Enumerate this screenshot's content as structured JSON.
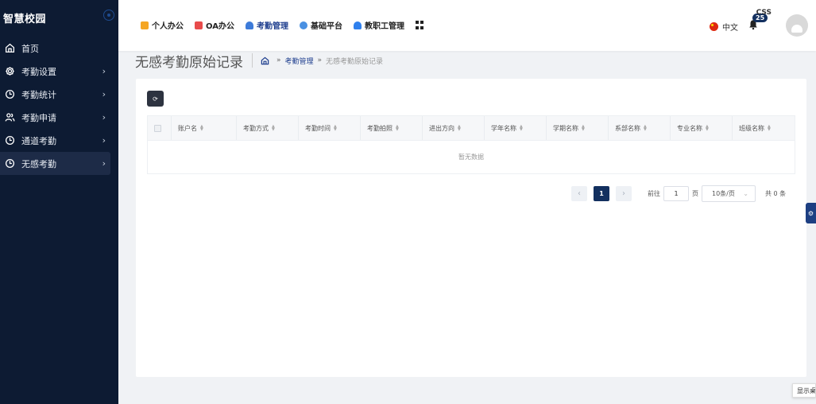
{
  "sidebar": {
    "logo": "智慧校园",
    "items": [
      {
        "label": "首页",
        "icon": "home-icon"
      },
      {
        "label": "考勤设置",
        "icon": "gear-icon"
      },
      {
        "label": "考勤统计",
        "icon": "clock-icon"
      },
      {
        "label": "考勤申请",
        "icon": "users-icon"
      },
      {
        "label": "通道考勤",
        "icon": "clock-icon"
      },
      {
        "label": "无感考勤",
        "icon": "clock-icon"
      }
    ]
  },
  "header": {
    "nav": [
      {
        "label": "个人办公",
        "color": "#f5a623"
      },
      {
        "label": "OA办公",
        "color": "#e84b4b"
      },
      {
        "label": "考勤管理",
        "color": "#3d7bd9"
      },
      {
        "label": "基础平台",
        "color": "#4a90e2"
      },
      {
        "label": "教职工管理",
        "color": "#2f80ed"
      }
    ],
    "language": "中文",
    "notification_count": "25",
    "username": "CSS"
  },
  "page": {
    "title": "无感考勤原始记录",
    "breadcrumb": {
      "module": "考勤管理",
      "current": "无感考勤原始记录",
      "sep1": "»",
      "sep2": "»"
    }
  },
  "table": {
    "columns": [
      "账户名",
      "考勤方式",
      "考勤时间",
      "考勤拍照",
      "进出方向",
      "学年名称",
      "学期名称",
      "系部名称",
      "专业名称",
      "班级名称"
    ],
    "empty_text": "暂无数据"
  },
  "pagination": {
    "prev": "‹",
    "current_page": "1",
    "next": "›",
    "goto_prefix": "前往",
    "goto_value": "1",
    "goto_suffix": "页",
    "page_size": "10条/页",
    "total": "共 0 条"
  },
  "floating": {
    "label": "显示桌"
  },
  "colors": {
    "sidebar_bg": "#0d1b33",
    "accent": "#13305f"
  }
}
